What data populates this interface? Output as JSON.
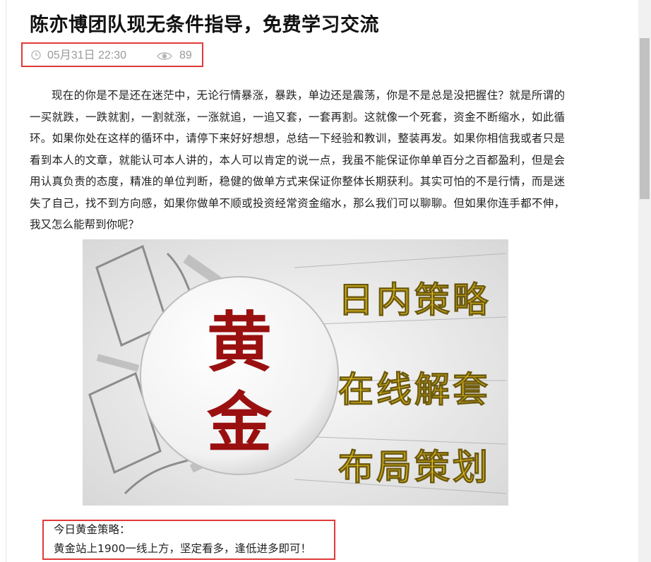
{
  "article": {
    "title": "陈亦博团队现无条件指导，免费学习交流",
    "meta": {
      "date": "05月31日 22:30",
      "views": "89",
      "date_icon": "clock-icon",
      "views_icon": "eye-icon"
    },
    "paragraph": "现在的你是不是还在迷茫中，无论行情暴涨，暴跌，单边还是震荡，你是不是总是没把握住？就是所谓的一买就跌，一跌就割，一割就涨，一涨就追，一追又套，一套再割。这就像一个死套，资金不断缩水，如此循环。如果你处在这样的循环中，请停下来好好想想，总结一下经验和教训，整装再发。如果你相信我或者只是看到本人的文章，就能认可本人讲的，本人可以肯定的说一点，我虽不能保证你单单百分之百都盈利，但是会用认真负责的态度，精准的单位判断，稳健的做单方式来保证你整体长期获利。其实可怕的不是行情，而是迷失了自己，找不到方向感，如果你做单不顺或投资经常资金缩水，那么我们可以聊聊。但如果你连手都不伸，我又怎么能帮到你呢？",
    "banner": {
      "circle_line1": "黄",
      "circle_line2": "金",
      "line1": "日内策略",
      "line2": "在线解套",
      "line3": "布局策划",
      "circle_text_color": "#9a1010",
      "slogan_color": "#e8c41a"
    },
    "strategy": {
      "label": "今日黄金策略：",
      "text": "黄金站上1900一线上方，坚定看多，逢低进多即可！"
    }
  },
  "colors": {
    "highlight_border": "#e03a3a",
    "meta_text": "#9a9a9a"
  }
}
